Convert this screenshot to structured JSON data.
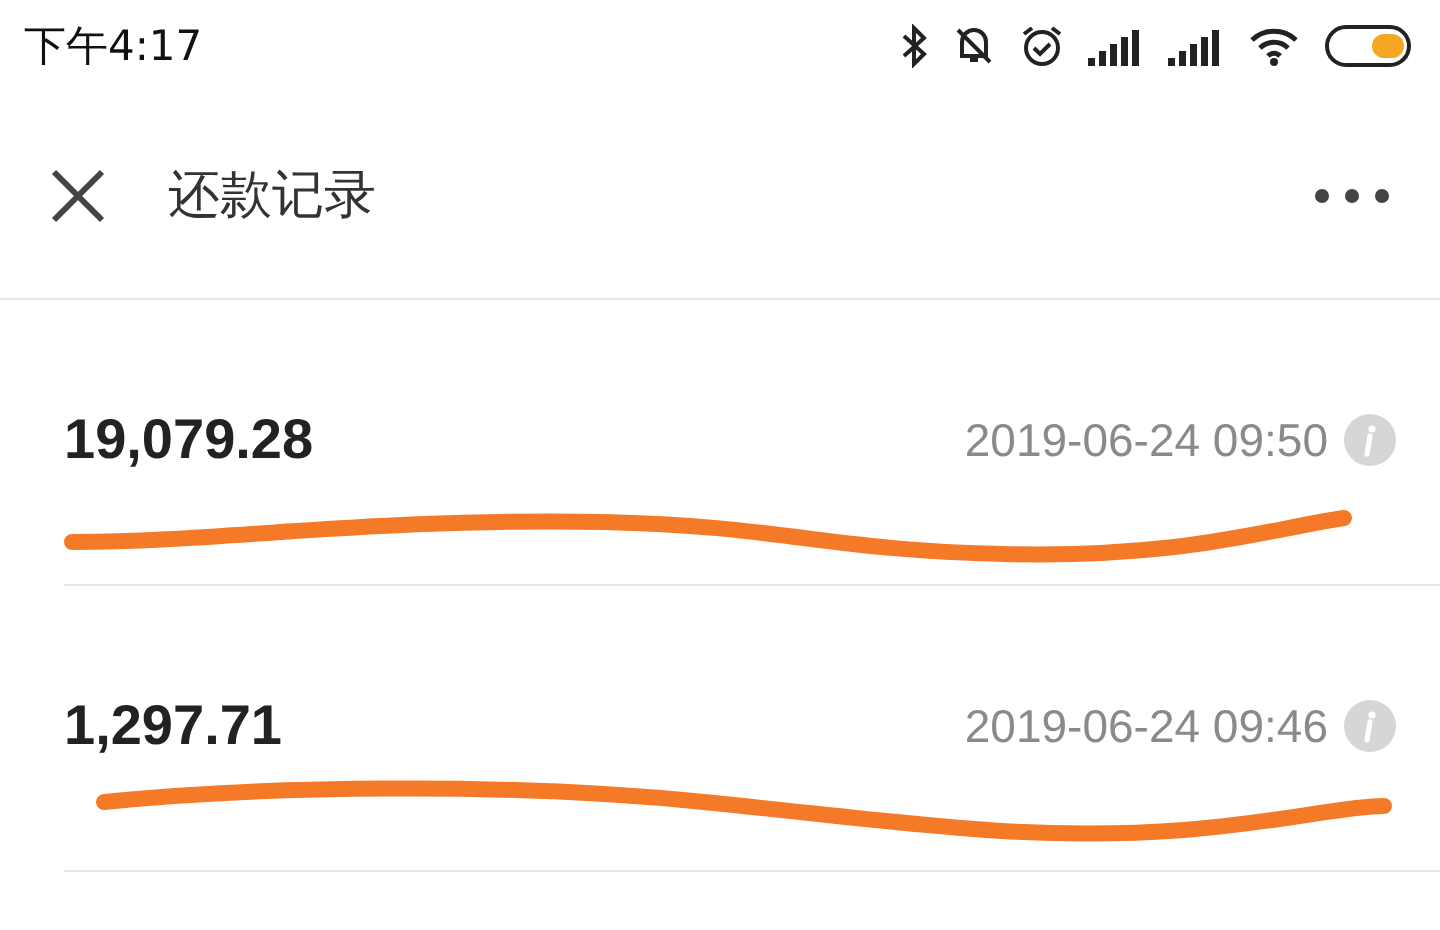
{
  "status_bar": {
    "time": "下午4:17"
  },
  "header": {
    "title": "还款记录"
  },
  "records": [
    {
      "amount": "19,079.28",
      "time": "2019-06-24 09:50"
    },
    {
      "amount": "1,297.71",
      "time": "2019-06-24 09:46"
    }
  ]
}
